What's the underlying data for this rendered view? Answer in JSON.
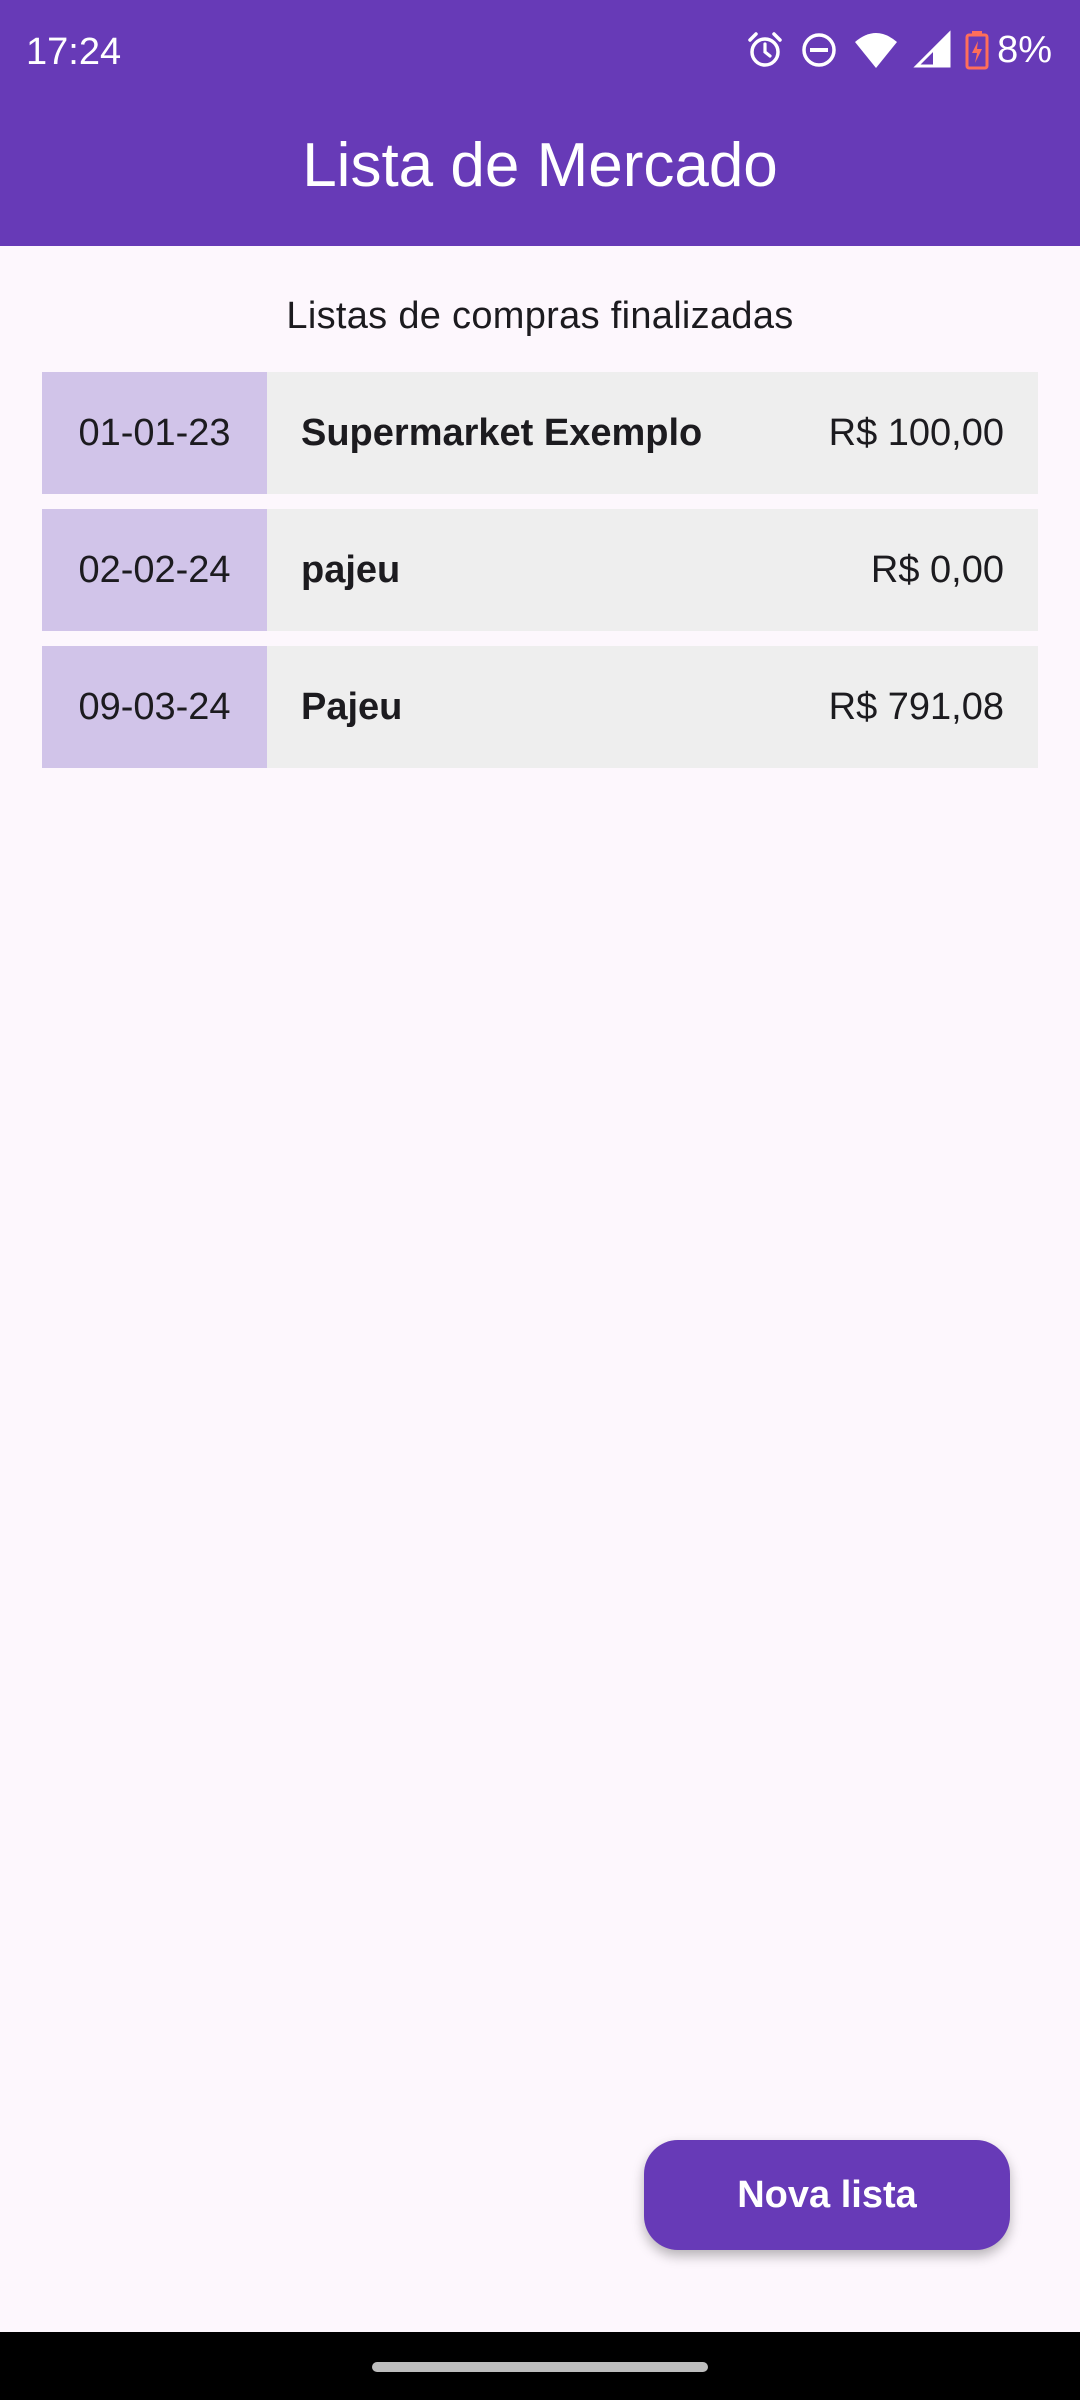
{
  "status_bar": {
    "time": "17:24",
    "battery": "8%",
    "icons": [
      "alarm-icon",
      "do-not-disturb-icon",
      "wifi-icon",
      "signal-icon",
      "battery-charging-icon"
    ]
  },
  "app_bar": {
    "title": "Lista de Mercado"
  },
  "section_title": "Listas de compras finalizadas",
  "lists": [
    {
      "date": "01-01-23",
      "name": "Supermarket Exemplo",
      "total": "R$ 100,00"
    },
    {
      "date": "02-02-24",
      "name": "pajeu",
      "total": "R$ 0,00"
    },
    {
      "date": "09-03-24",
      "name": "Pajeu",
      "total": "R$ 791,08"
    }
  ],
  "fab": {
    "label": "Nova lista"
  },
  "colors": {
    "primary": "#673ab7",
    "date_cell": "#d1c4e9",
    "row_background": "#eeeeee",
    "page_background": "#fdf7fd",
    "battery_low": "#ff6e5a"
  }
}
